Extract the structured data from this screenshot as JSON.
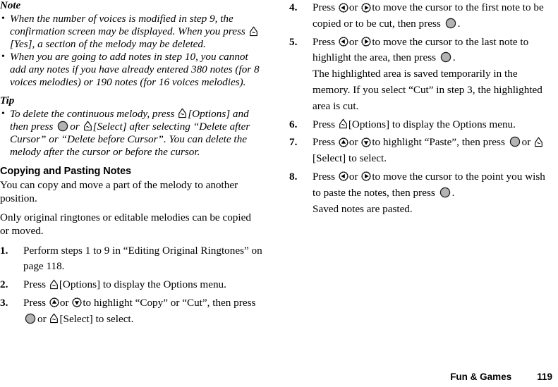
{
  "document": {
    "type": "manual-page",
    "footer": {
      "chapter": "Fun & Games",
      "page_number": "119"
    }
  },
  "icons": {
    "softkey": "left-softkey-icon",
    "center": "center-key-icon",
    "up": "up-navigation-key-icon",
    "down": "down-navigation-key-icon",
    "left": "left-navigation-key-icon",
    "right": "right-navigation-key-icon"
  },
  "left_column": {
    "note": {
      "heading": "Note",
      "bullets": [
        {
          "part1": "When the number of voices is modified in step 9, the confirmation screen may be displayed. When you press",
          "part2": "[Yes], a section of the melody may be deleted."
        },
        {
          "part1": "When you are going to add notes in step 10, you cannot add any notes if you have already entered 380 notes (for 8 voices melodies) or 190 notes (for 16 voices melodies).",
          "part2": ""
        }
      ]
    },
    "tip": {
      "heading": "Tip",
      "bullet": {
        "seg1": "To delete the continuous melody, press",
        "seg2": "[Options] and then press",
        "seg3": "or",
        "seg4": "[Select] after selecting “Delete after Cursor” or “Delete before Cursor”. You can delete the melody after the cursor or before the cursor."
      }
    },
    "section": {
      "heading": "Copying and Pasting Notes",
      "paragraph1": "You can copy and move a part of the melody to another position.",
      "paragraph2": "Only original ringtones or editable melodies can be copied or moved.",
      "steps": [
        {
          "num": "1.",
          "seg1": "Perform steps 1 to 9 in “Editing Original Ringtones” on page 118.",
          "seg2": "",
          "seg3": "",
          "seg4": ""
        },
        {
          "num": "2.",
          "seg1": "Press",
          "seg2": "[Options] to display the Options menu.",
          "seg3": "",
          "seg4": ""
        },
        {
          "num": "3.",
          "seg1": "Press",
          "seg2": "or",
          "seg3": "to highlight “Copy” or “Cut”, then press",
          "seg4": "or",
          "seg5": "[Select] to select."
        }
      ]
    }
  },
  "right_column": {
    "steps": [
      {
        "num": "4.",
        "seg1": "Press",
        "seg2": "or",
        "seg3": "to move the cursor to the first note to be copied or to be cut, then press",
        "seg4": "."
      },
      {
        "num": "5.",
        "seg1": "Press",
        "seg2": "or",
        "seg3": "to move the cursor to the last note to highlight the area, then press",
        "seg4": ".",
        "sub": "The highlighted area is saved temporarily in the memory. If you select “Cut” in step 3, the highlighted area is cut."
      },
      {
        "num": "6.",
        "seg1": "Press",
        "seg2": "[Options] to display the Options menu."
      },
      {
        "num": "7.",
        "seg1": "Press",
        "seg2": "or",
        "seg3": "to highlight “Paste”, then press",
        "seg4": "or",
        "seg5": "[Select] to select."
      },
      {
        "num": "8.",
        "seg1": "Press",
        "seg2": "or",
        "seg3": "to move the cursor to the point you wish to paste the notes, then press",
        "seg4": ".",
        "sub": "Saved notes are pasted."
      }
    ]
  }
}
